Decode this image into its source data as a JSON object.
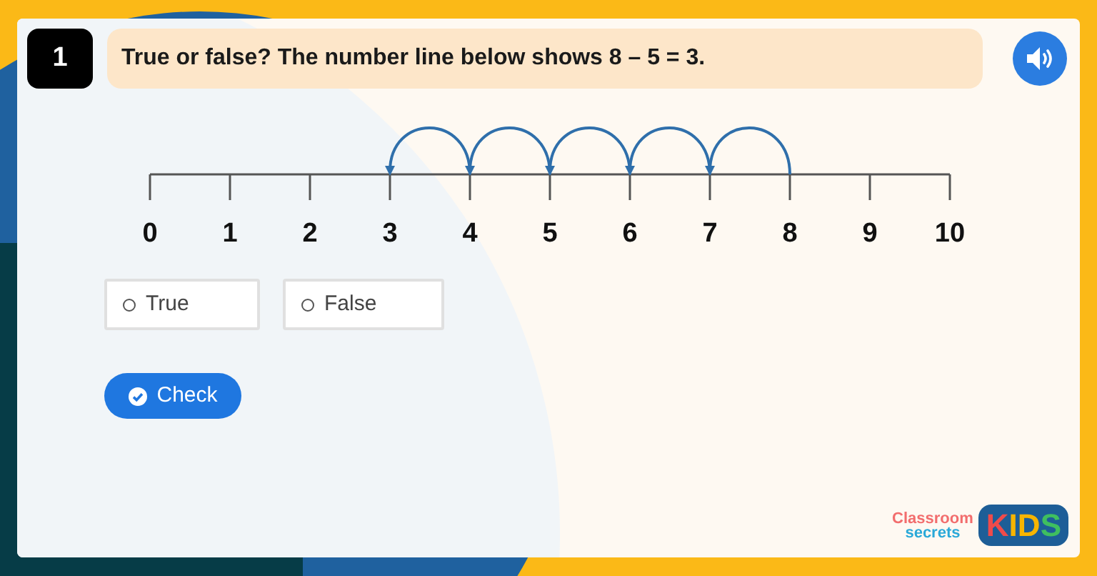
{
  "question": {
    "number": "1",
    "text": "True or false? The number line below shows 8 – 5 = 3."
  },
  "number_line": {
    "ticks": [
      {
        "label": "0",
        "arc_from_right": false
      },
      {
        "label": "1",
        "arc_from_right": false
      },
      {
        "label": "2",
        "arc_from_right": false
      },
      {
        "label": "3",
        "arc_from_right": true
      },
      {
        "label": "4",
        "arc_from_right": true
      },
      {
        "label": "5",
        "arc_from_right": true
      },
      {
        "label": "6",
        "arc_from_right": true
      },
      {
        "label": "7",
        "arc_from_right": true
      },
      {
        "label": "8",
        "arc_from_right": false
      },
      {
        "label": "9",
        "arc_from_right": false
      },
      {
        "label": "10",
        "arc_from_right": false
      }
    ]
  },
  "options": [
    {
      "label": "True",
      "selected": false
    },
    {
      "label": "False",
      "selected": false
    }
  ],
  "check_button": "Check",
  "logo": {
    "line_1": "Classroom",
    "line_2": "secrets",
    "badge": "KIDS"
  }
}
